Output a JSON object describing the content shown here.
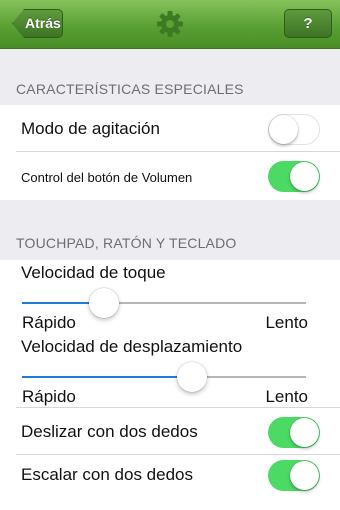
{
  "header": {
    "back_label": "Atrás",
    "help_label": "?",
    "icon": "gear-icon"
  },
  "special_features": {
    "title": "CARACTERÍSTICAS ESPECIALES",
    "shake_mode": {
      "label": "Modo de agitación",
      "on": false
    },
    "volume_button_control": {
      "label": "Control del botón de Volumen",
      "on": true
    }
  },
  "touchpad": {
    "title": "TOUCHPAD, RATÓN Y TECLADO",
    "tap_speed": {
      "label": "Velocidad de toque",
      "min_label": "Rápido",
      "max_label": "Lento",
      "value": 0.29
    },
    "scroll_speed": {
      "label": "Velocidad de desplazamiento",
      "min_label": "Rápido",
      "max_label": "Lento",
      "value": 0.6
    },
    "two_finger_swipe": {
      "label": "Deslizar con dos dedos",
      "on": true
    },
    "two_finger_zoom": {
      "label": "Escalar con dos dedos",
      "on": true
    }
  },
  "colors": {
    "accent_green": "#4cd964",
    "slider_blue": "#1e7bd9",
    "header_green": "#5aa033"
  }
}
